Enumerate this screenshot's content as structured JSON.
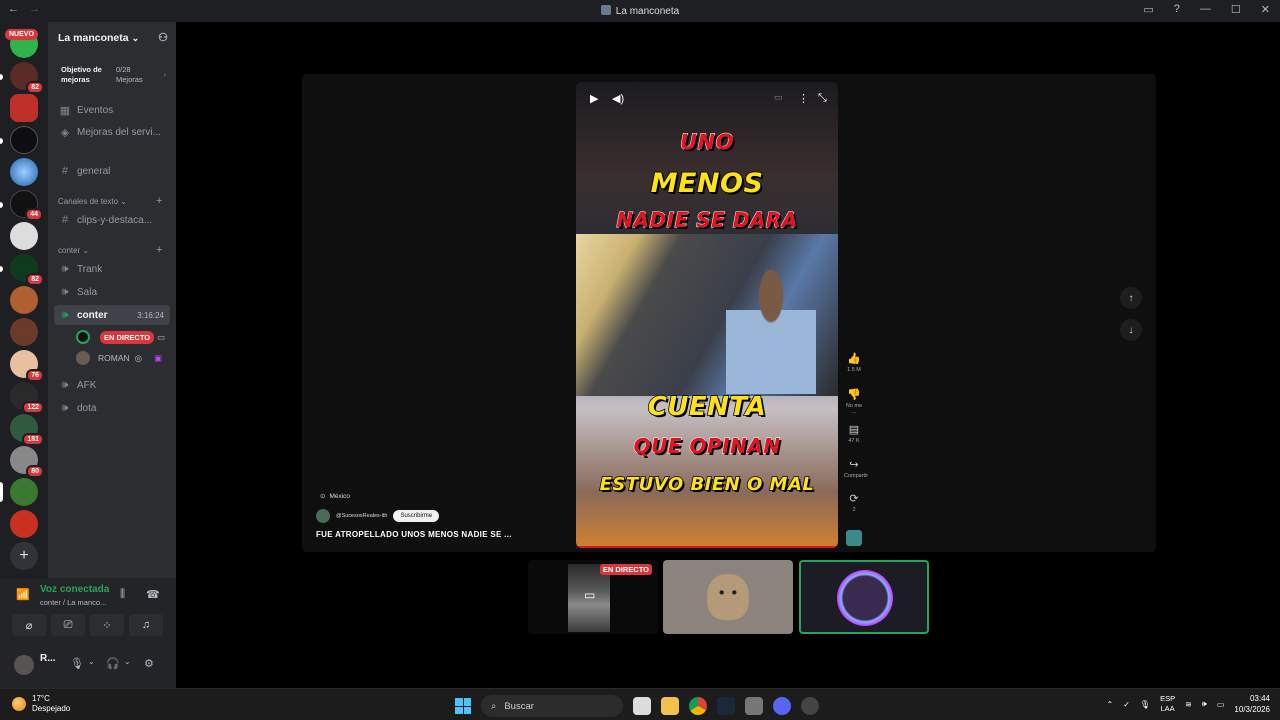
{
  "window": {
    "title": "La manconeta",
    "nav_back": "←",
    "nav_forward": "→",
    "inbox_icon": "inbox-icon",
    "help_icon": "help-icon",
    "controls": [
      "—",
      "☐",
      "✕"
    ]
  },
  "server_rail": {
    "new_badge": "NUEVO",
    "badges": [
      "82",
      "44",
      "82",
      "76",
      "122",
      "181",
      "80"
    ],
    "add_server": "+"
  },
  "guild": {
    "name": "La manconeta",
    "boost": {
      "label_line1": "Objetivo de",
      "label_line2": "mejoras",
      "count_line1": "0/28",
      "count_line2": "Mejoras"
    },
    "events": "Eventos",
    "server_boosts": "Mejoras del servi...",
    "general": "general",
    "text_category": "Canales de texto",
    "clips": "clips-y-destaca...",
    "voice_category": "conter",
    "voice_channels": {
      "trank": "Trank",
      "sala": "Sala",
      "conter": "conter",
      "conter_time": "3:16:24",
      "afk": "AFK",
      "dota": "dota"
    },
    "voice_users": {
      "live_label": "EN DIRECTO",
      "roman": "ROMAN"
    }
  },
  "voice_panel": {
    "status": "Voz conectada",
    "channel": "conter / La manco..."
  },
  "user_panel": {
    "name": "R..."
  },
  "video": {
    "caption1": "UNO",
    "caption2": "MENOS",
    "caption3": "NADIE SE DARA",
    "caption4": "CUENTA",
    "caption5": "QUE OPINAN",
    "caption6": "ESTUVO BIEN O MAL",
    "play": "▶",
    "volume": "🔊",
    "more": "⋮",
    "like_count": "1.5 M",
    "dislike_label": "No me ...",
    "comments": "47 K",
    "share": "Compartir",
    "remix": "2",
    "location": "México",
    "channel": "@SucesosReales-ith",
    "subscribe": "Suscribirme",
    "title": "FUE ATROPELLADO  UNOS MENOS NADIE SE ...",
    "nav_up": "↑",
    "nav_down": "↓"
  },
  "participants": {
    "live_label": "EN DIRECTO"
  },
  "taskbar": {
    "temp": "17°C",
    "weather": "Despejado",
    "search": "Buscar",
    "lang1": "ESP",
    "lang2": "LAA",
    "time": "03:44",
    "date": "10/3/2026"
  },
  "colors": {
    "online_green": "#23a55a",
    "live_red": "#da373c",
    "caption_yellow": "#fde11a",
    "caption_red": "#e0141e"
  }
}
